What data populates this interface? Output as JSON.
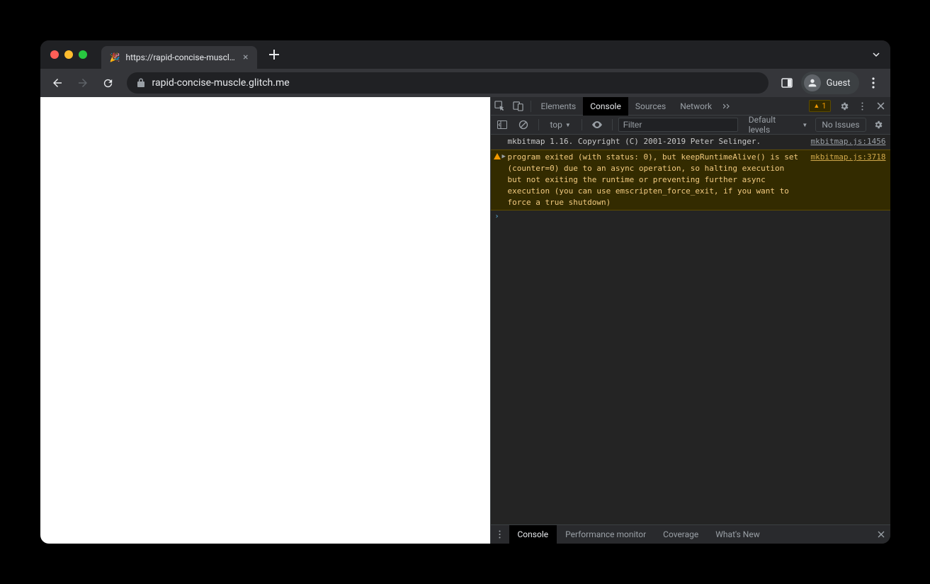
{
  "tab": {
    "favicon": "🎉",
    "title": "https://rapid-concise-muscle.g"
  },
  "omnibox": {
    "url": "rapid-concise-muscle.glitch.me"
  },
  "profile": {
    "label": "Guest"
  },
  "devtools": {
    "tabs": {
      "elements": "Elements",
      "console": "Console",
      "sources": "Sources",
      "network": "Network"
    },
    "warn_count": "1",
    "toolbar": {
      "context": "top",
      "filter_placeholder": "Filter",
      "levels": "Default levels",
      "issues": "No Issues"
    },
    "logs": [
      {
        "type": "info",
        "msg": "mkbitmap 1.16. Copyright (C) 2001-2019 Peter Selinger.",
        "src": "mkbitmap.js:1456"
      },
      {
        "type": "warn",
        "msg": "program exited (with status: 0), but keepRuntimeAlive() is set (counter=0) due to an async operation, so halting execution but not exiting the runtime or preventing further async execution (you can use emscripten_force_exit, if you want to force a true shutdown)",
        "src": "mkbitmap.js:3718"
      }
    ],
    "drawer": {
      "tabs": {
        "console": "Console",
        "perf": "Performance monitor",
        "coverage": "Coverage",
        "whatsnew": "What's New"
      }
    }
  }
}
